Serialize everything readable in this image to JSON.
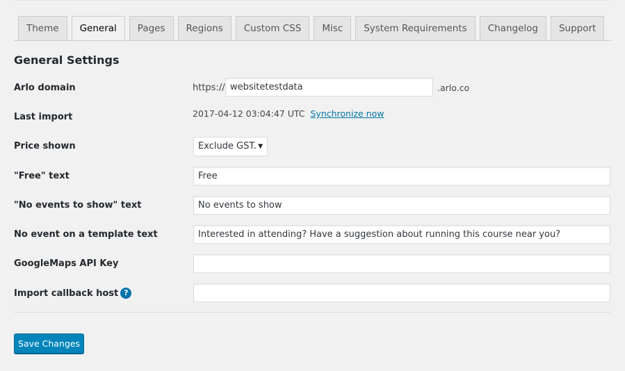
{
  "tabs": [
    {
      "label": "Theme",
      "active": false
    },
    {
      "label": "General",
      "active": true
    },
    {
      "label": "Pages",
      "active": false
    },
    {
      "label": "Regions",
      "active": false
    },
    {
      "label": "Custom CSS",
      "active": false
    },
    {
      "label": "Misc",
      "active": false
    },
    {
      "label": "System Requirements",
      "active": false
    },
    {
      "label": "Changelog",
      "active": false
    },
    {
      "label": "Support",
      "active": false
    }
  ],
  "section_title": "General Settings",
  "fields": {
    "arlo_domain": {
      "label": "Arlo domain",
      "prefix": "https://",
      "value": "websitetestdata",
      "suffix": ".arlo.co"
    },
    "last_import": {
      "label": "Last import",
      "value": "2017-04-12 03:04:47 UTC",
      "link": "Synchronize now"
    },
    "price_shown": {
      "label": "Price shown",
      "selected": "Exclude GST."
    },
    "free_text": {
      "label": "\"Free\" text",
      "value": "Free"
    },
    "no_events_text": {
      "label": "\"No events to show\" text",
      "value": "No events to show"
    },
    "no_event_template_text": {
      "label": "No event on a template text",
      "value": "Interested in attending? Have a suggestion about running this course near you?"
    },
    "googlemaps_api_key": {
      "label": "GoogleMaps API Key",
      "value": ""
    },
    "import_callback_host": {
      "label": "Import callback host",
      "help_icon": "?",
      "value": ""
    }
  },
  "save_button": "Save Changes",
  "colors": {
    "primary_button": "#0085ba",
    "link": "#0073aa",
    "background": "#f1f1f1"
  }
}
